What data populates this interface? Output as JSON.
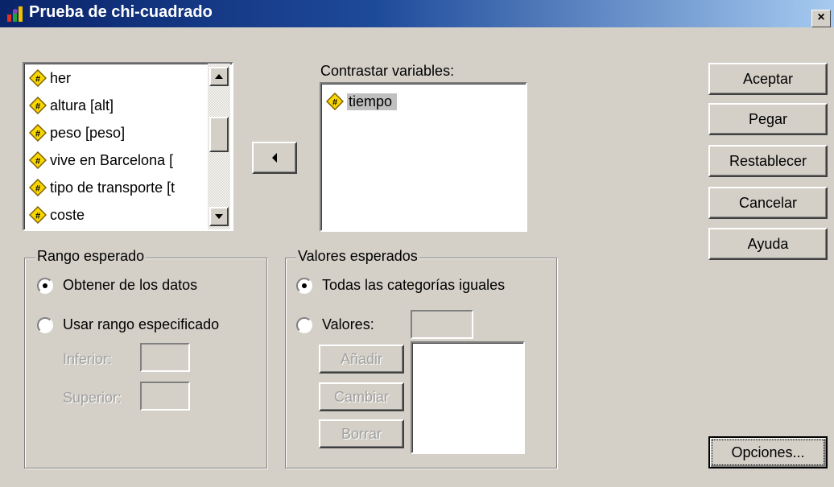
{
  "window": {
    "title": "Prueba de chi-cuadrado",
    "close_label": "×"
  },
  "variables": [
    {
      "label": "her"
    },
    {
      "label": "altura [alt]"
    },
    {
      "label": "peso [peso]"
    },
    {
      "label": "vive en Barcelona ["
    },
    {
      "label": "tipo de transporte [t"
    },
    {
      "label": "coste"
    }
  ],
  "test_variables": {
    "label": "Contrastar variables:",
    "items": [
      {
        "label": "tiempo",
        "selected": true
      }
    ]
  },
  "buttons": {
    "accept": "Aceptar",
    "paste": "Pegar",
    "reset": "Restablecer",
    "cancel": "Cancelar",
    "help": "Ayuda",
    "options": "Opciones..."
  },
  "expected_range": {
    "title": "Rango esperado",
    "from_data": {
      "label": "Obtener de los datos",
      "selected": true
    },
    "specified": {
      "label": "Usar rango especificado",
      "selected": false
    },
    "lower_label": "Inferior:",
    "upper_label": "Superior:"
  },
  "expected_values": {
    "title": "Valores esperados",
    "all_equal": {
      "label": "Todas las categorías iguales",
      "selected": true
    },
    "values": {
      "label": "Valores:",
      "selected": false
    },
    "add": "Añadir",
    "change": "Cambiar",
    "remove": "Borrar"
  },
  "colors": {
    "title_start": "#0a246a",
    "title_end": "#a6caf0",
    "face": "#d4d0c8",
    "selection": "#c0c0c0"
  }
}
